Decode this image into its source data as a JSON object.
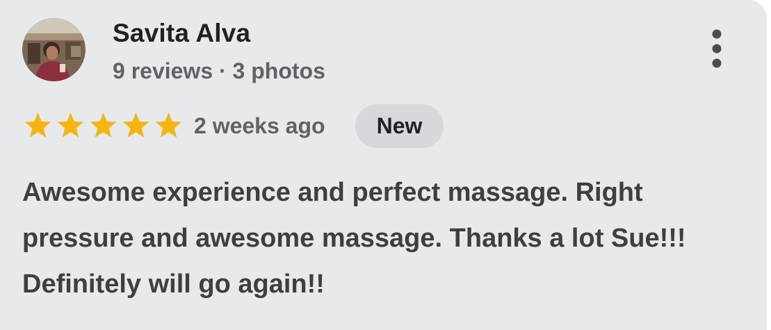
{
  "review": {
    "author_name": "Savita Alva",
    "author_meta": "9 reviews · 3 photos",
    "rating": 5,
    "rating_max": 5,
    "time_ago": "2 weeks ago",
    "badge": "New",
    "text": "Awesome experience and perfect massage. Right pressure and awesome massage. Thanks a lot Sue!!! Definitely will go again!!"
  },
  "icons": {
    "avatar": "user-photo",
    "more": "more-vert-icon",
    "star": "star-icon"
  },
  "colors": {
    "card_background": "#e8e9eb",
    "star": "#f6b40e",
    "badge_background": "#d6d8db",
    "primary_text": "#202124",
    "secondary_text": "#5f6368",
    "body_text": "#3c4043"
  }
}
